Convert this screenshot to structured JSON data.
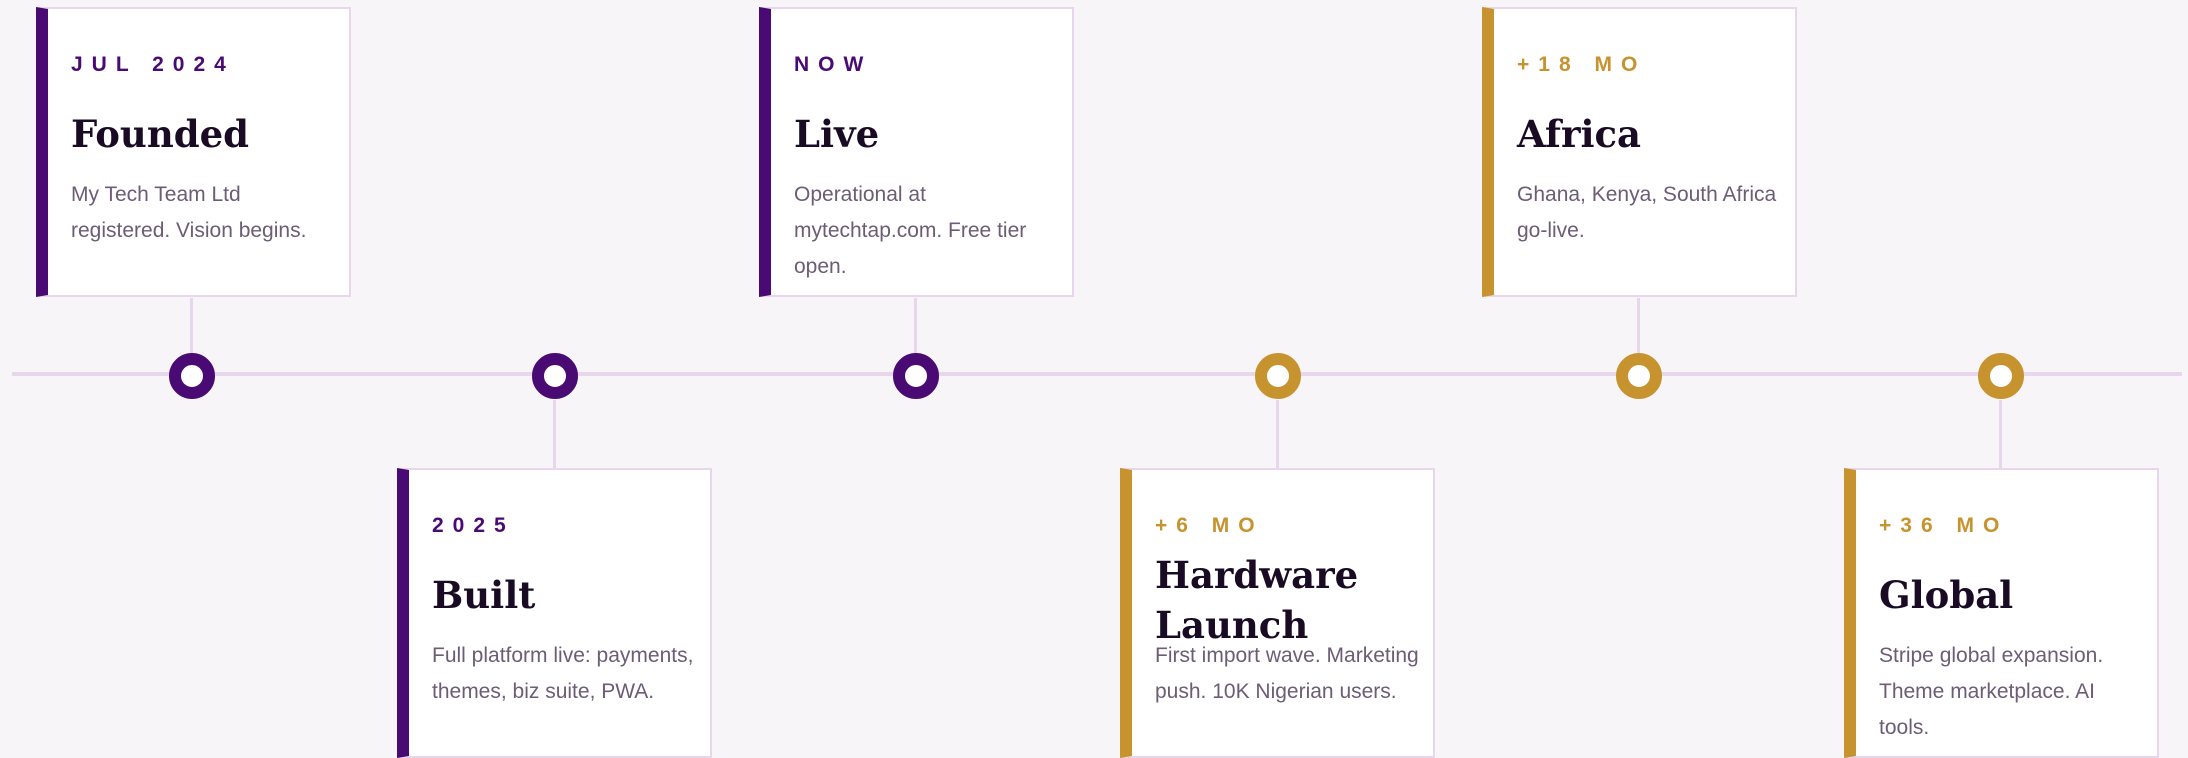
{
  "colors": {
    "purple": "#4a0a73",
    "gold": "#c7932f",
    "line": "#e7d6ec",
    "background": "#f8f5f9"
  },
  "milestones": [
    {
      "tag": "JUL 2024",
      "title": "Founded",
      "description": "My Tech Team Ltd registered. Vision begins."
    },
    {
      "tag": "2025",
      "title": "Built",
      "description": "Full platform live: payments, themes, biz suite, PWA."
    },
    {
      "tag": "NOW",
      "title": "Live",
      "description": "Operational at mytechtap.com. Free tier open."
    },
    {
      "tag": "+6 MO",
      "title": "Hardware Launch",
      "description": "First import wave. Marketing push. 10K Nigerian users."
    },
    {
      "tag": "+18 MO",
      "title": "Africa",
      "description": "Ghana, Kenya, South Africa go-live."
    },
    {
      "tag": "+36 MO",
      "title": "Global",
      "description": "Stripe global expansion. Theme marketplace. AI tools."
    }
  ]
}
